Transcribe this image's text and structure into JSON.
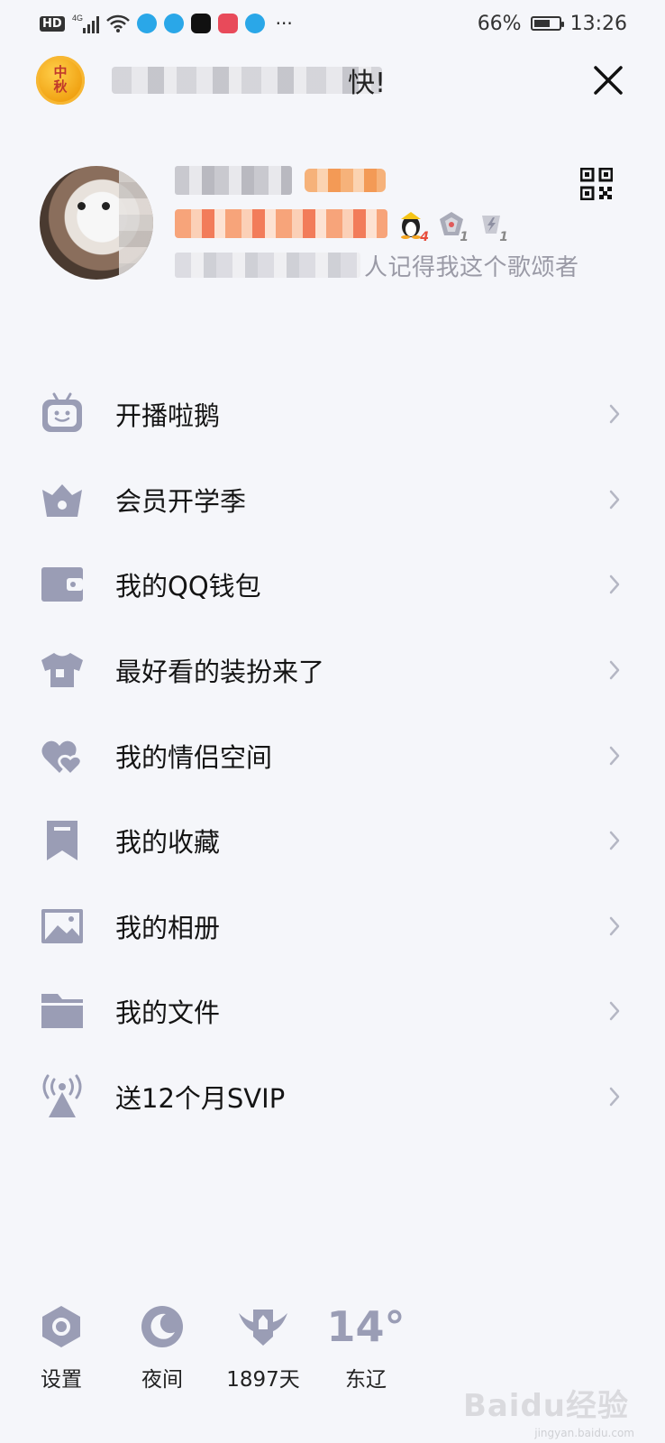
{
  "status_bar": {
    "hd": "HD",
    "network": "4G",
    "more": "···",
    "battery_percent": "66%",
    "battery_level": 0.66,
    "time": "13:26"
  },
  "banner": {
    "badge_top": "中",
    "badge_bottom": "秋",
    "visible_text": "快!"
  },
  "profile": {
    "signature_visible": "人记得我这个歌颂者",
    "badges": [
      {
        "name": "qq-penguin-badge",
        "count": "4"
      },
      {
        "name": "armor-badge",
        "count": "1"
      },
      {
        "name": "lightning-badge",
        "count": "1"
      }
    ]
  },
  "menu": {
    "items": [
      {
        "label": "开播啦鹅",
        "icon": "tv-robot-icon"
      },
      {
        "label": "会员开学季",
        "icon": "crown-icon"
      },
      {
        "label": "我的QQ钱包",
        "icon": "wallet-icon"
      },
      {
        "label": "最好看的装扮来了",
        "icon": "tshirt-icon"
      },
      {
        "label": "我的情侣空间",
        "icon": "hearts-icon"
      },
      {
        "label": "我的收藏",
        "icon": "bookmark-icon"
      },
      {
        "label": "我的相册",
        "icon": "photo-icon"
      },
      {
        "label": "我的文件",
        "icon": "folder-icon"
      },
      {
        "label": "送12个月SVIP",
        "icon": "broadcast-icon"
      }
    ]
  },
  "bottom_bar": {
    "settings_label": "设置",
    "night_label": "夜间",
    "days_label": "1897天",
    "temperature": "14°",
    "location": "东辽"
  },
  "watermark": {
    "main": "Baidu经验",
    "sub": "jingyan.baidu.com"
  },
  "colors": {
    "icon": "#9a9db5",
    "background": "#f5f6fa",
    "text": "#141414",
    "muted": "#9a9aa6"
  }
}
